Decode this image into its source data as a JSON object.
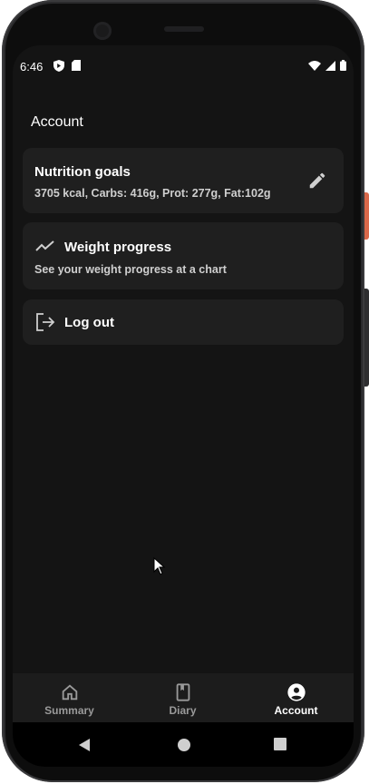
{
  "status_bar": {
    "time": "6:46",
    "left_icons": [
      "shield-icon",
      "sd-card-icon"
    ],
    "right_icons": [
      "wifi-icon",
      "signal-icon",
      "battery-icon"
    ]
  },
  "page": {
    "title": "Account"
  },
  "cards": {
    "nutrition": {
      "title": "Nutrition goals",
      "subtitle": "3705 kcal, Carbs: 416g, Prot: 277g, Fat:102g",
      "action_icon": "edit-icon"
    },
    "weight": {
      "icon": "trending-up-icon",
      "title": "Weight progress",
      "subtitle": "See your weight progress at a chart"
    },
    "logout": {
      "icon": "logout-icon",
      "title": "Log out"
    }
  },
  "bottom_nav": {
    "items": [
      {
        "label": "Summary",
        "icon": "home-icon",
        "active": false
      },
      {
        "label": "Diary",
        "icon": "book-icon",
        "active": false
      },
      {
        "label": "Account",
        "icon": "account-circle-icon",
        "active": true
      }
    ]
  },
  "system_nav": {
    "buttons": [
      "back-icon",
      "home-circle-icon",
      "recents-icon"
    ]
  },
  "colors": {
    "background": "#141414",
    "card": "#1f1f1f",
    "nav_bar": "#1c1c1c",
    "text_primary": "#ffffff",
    "text_secondary": "#cfcfcf",
    "nav_inactive": "#9a9a9a",
    "device_accent": "#d9684a"
  }
}
